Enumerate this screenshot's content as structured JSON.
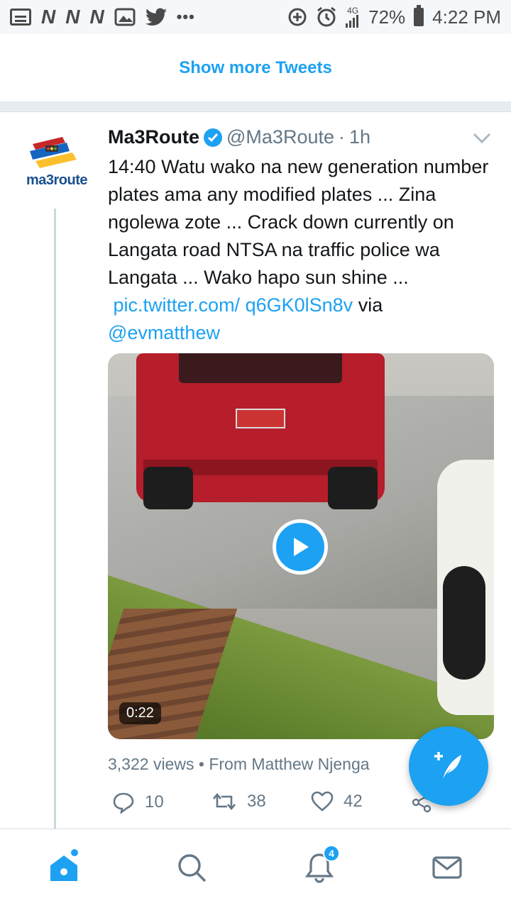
{
  "status_bar": {
    "battery": "72%",
    "time": "4:22 PM",
    "network": "4G",
    "icons": [
      "message-icon",
      "n-icon",
      "n-icon",
      "n-icon",
      "image-icon",
      "twitter-bird-icon",
      "more-dots-icon",
      "data-saver-icon",
      "alarm-icon",
      "signal-icon",
      "battery-icon"
    ]
  },
  "timeline": {
    "show_more_label": "Show more Tweets"
  },
  "tweet": {
    "avatar_label": "ma3route",
    "name": "Ma3Route",
    "handle": "@Ma3Route",
    "separator": "·",
    "time": "1h",
    "text_main": "14:40 Watu wako na new generation number plates ama any modified plates ... Zina ngolewa zote ... Crack down currently on Langata road NTSA na traffic police wa Langata ... Wako hapo sun shine ...",
    "link_pic": "pic.twitter.com/",
    "link_pic_tail": "q6GK0lSn8v",
    "via_text": "via",
    "via_link": "@evmatthew",
    "video_duration": "0:22",
    "views": "3,322 views",
    "bullet": "•",
    "from": "From Matthew Njenga",
    "replies": "10",
    "retweets": "38",
    "likes": "42"
  },
  "bottom_nav": {
    "notifications_badge": "4",
    "items": [
      "home",
      "search",
      "notifications",
      "messages"
    ]
  },
  "colors": {
    "accent": "#1da1f2",
    "text": "#14171a",
    "muted": "#657786"
  }
}
